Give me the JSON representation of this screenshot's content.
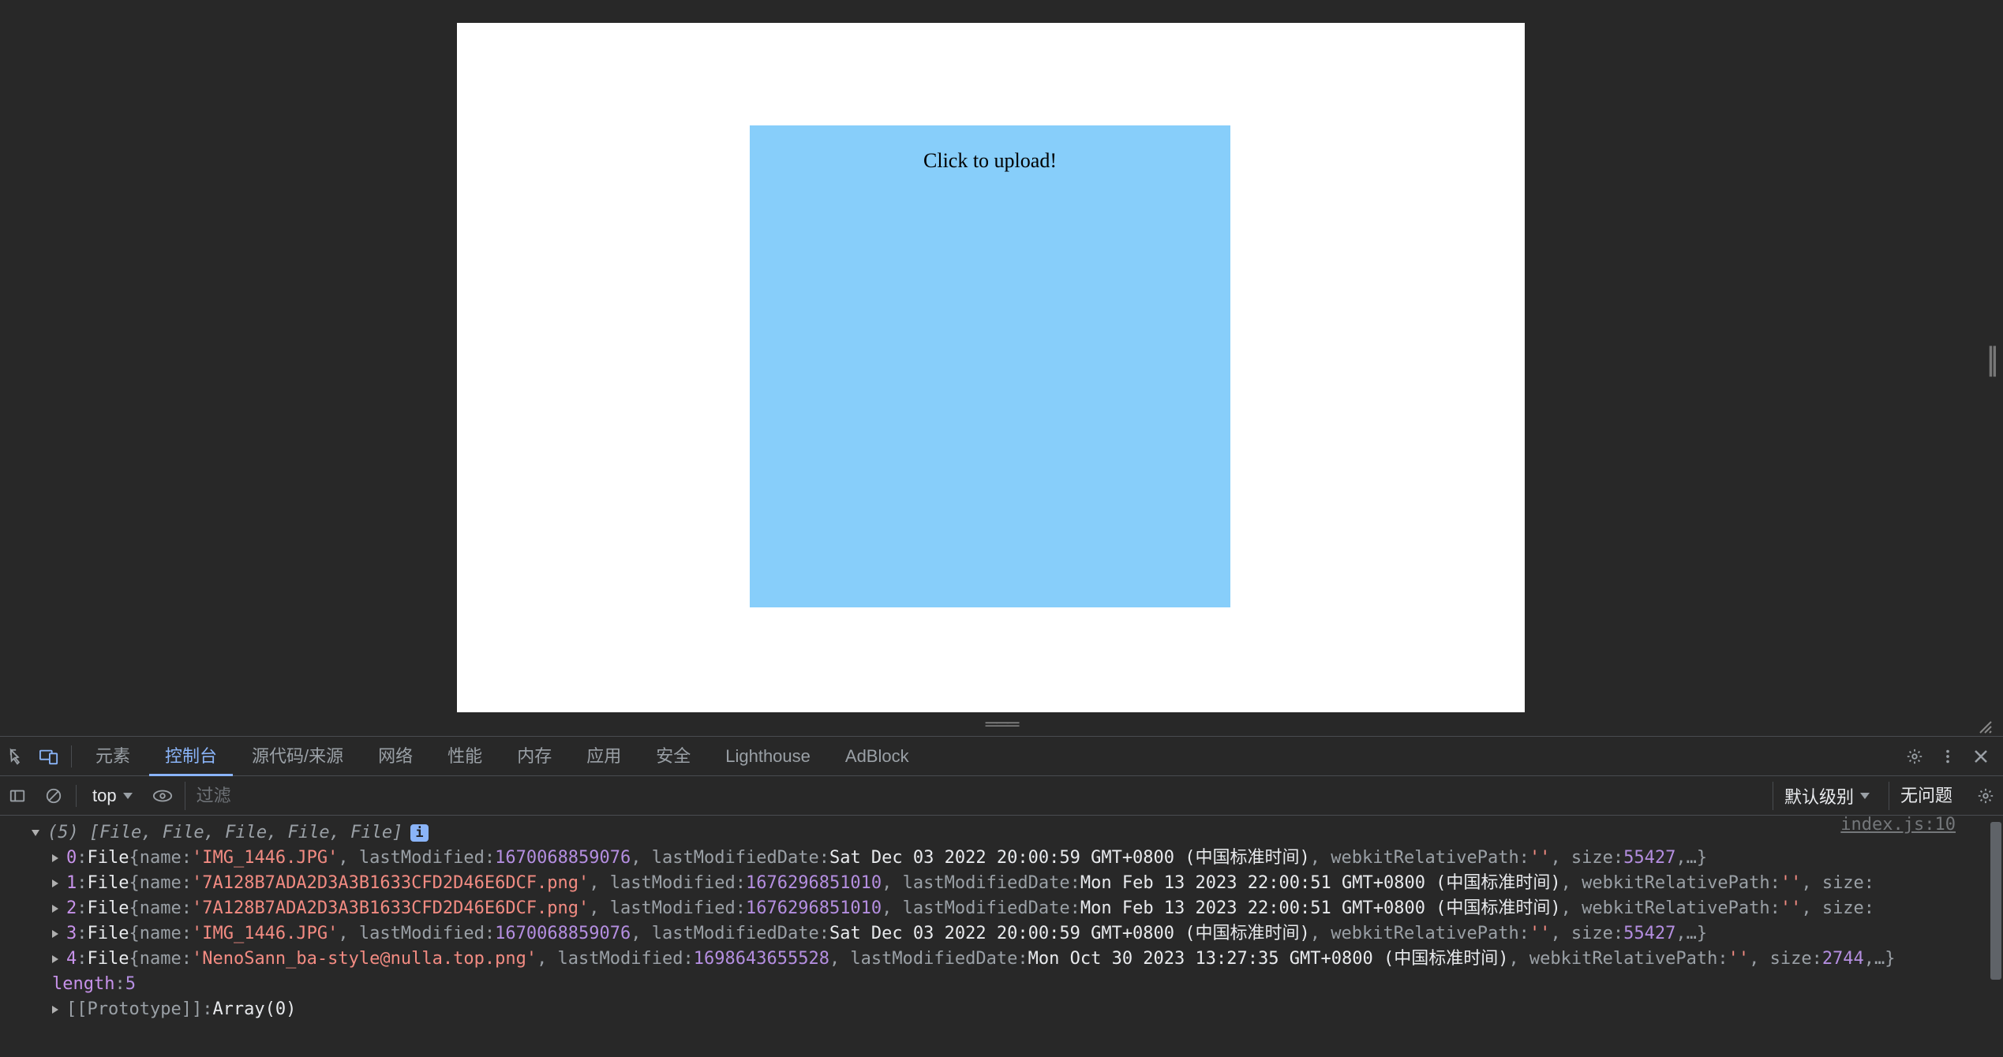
{
  "page": {
    "upload_label": "Click to upload!"
  },
  "devtools": {
    "tabs": {
      "elements": "元素",
      "console": "控制台",
      "sources": "源代码/来源",
      "network": "网络",
      "performance": "性能",
      "memory": "内存",
      "application": "应用",
      "security": "安全",
      "lighthouse": "Lighthouse",
      "adblock": "AdBlock"
    },
    "toolbar": {
      "context": "top",
      "filter_placeholder": "过滤",
      "levels": "默认级别",
      "issues": "无问题"
    },
    "source_link": "index.js:10",
    "array_header": "(5) [File, File, File, File, File]",
    "info_badge": "i",
    "files": [
      {
        "index": "0",
        "name": "IMG_1446.JPG",
        "lastModified": "1670068859076",
        "lastModifiedDate": "Sat Dec 03 2022 20:00:59 GMT+0800 (中国标准时间)",
        "size": "55427"
      },
      {
        "index": "1",
        "name": "7A128B7ADA2D3A3B1633CFD2D46E6DCF.png",
        "lastModified": "1676296851010",
        "lastModifiedDate": "Mon Feb 13 2023 22:00:51 GMT+0800 (中国标准时间)",
        "size_trailing": true
      },
      {
        "index": "2",
        "name": "7A128B7ADA2D3A3B1633CFD2D46E6DCF.png",
        "lastModified": "1676296851010",
        "lastModifiedDate": "Mon Feb 13 2023 22:00:51 GMT+0800 (中国标准时间)",
        "size_trailing": true
      },
      {
        "index": "3",
        "name": "IMG_1446.JPG",
        "lastModified": "1670068859076",
        "lastModifiedDate": "Sat Dec 03 2022 20:00:59 GMT+0800 (中国标准时间)",
        "size": "55427"
      },
      {
        "index": "4",
        "name": "NenoSann_ba-style@nulla.top.png",
        "lastModified": "1698643655528",
        "lastModifiedDate": "Mon Oct 30 2023 13:27:35 GMT+0800 (中国标准时间)",
        "size": "2744"
      }
    ],
    "length_label": "length",
    "length_value": "5",
    "prototype_label": "[[Prototype]]",
    "prototype_value": "Array(0)",
    "strings": {
      "file_type": "File",
      "name_key": "name",
      "lastModified_key": "lastModified",
      "lastModifiedDate_key": "lastModifiedDate",
      "webkitRelativePath_key": "webkitRelativePath",
      "webkitRelativePath_val": "''",
      "size_key": "size"
    }
  }
}
